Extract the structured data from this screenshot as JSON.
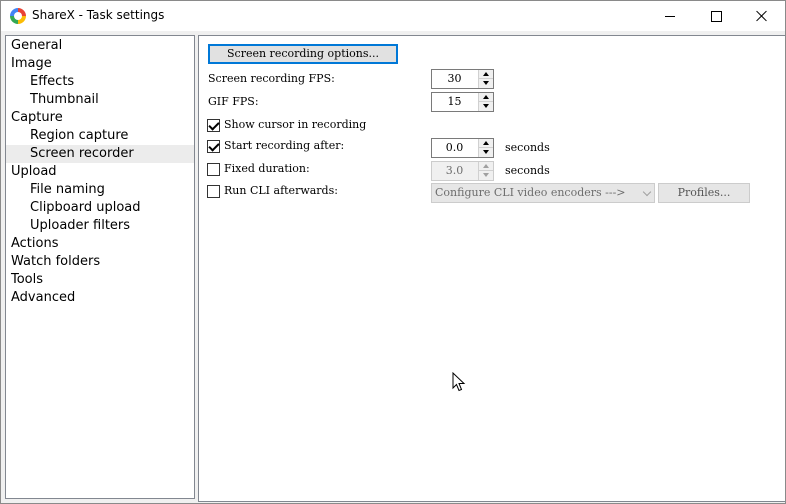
{
  "window": {
    "title": "ShareX - Task settings"
  },
  "nav": {
    "items": [
      {
        "label": "General",
        "level": 0
      },
      {
        "label": "Image",
        "level": 0
      },
      {
        "label": "Effects",
        "level": 1
      },
      {
        "label": "Thumbnail",
        "level": 1
      },
      {
        "label": "Capture",
        "level": 0
      },
      {
        "label": "Region capture",
        "level": 1
      },
      {
        "label": "Screen recorder",
        "level": 1,
        "selected": true
      },
      {
        "label": "Upload",
        "level": 0
      },
      {
        "label": "File naming",
        "level": 1
      },
      {
        "label": "Clipboard upload",
        "level": 1
      },
      {
        "label": "Uploader filters",
        "level": 1
      },
      {
        "label": "Actions",
        "level": 0
      },
      {
        "label": "Watch folders",
        "level": 0
      },
      {
        "label": "Tools",
        "level": 0
      },
      {
        "label": "Advanced",
        "level": 0
      }
    ]
  },
  "screen_recorder": {
    "options_button": "Screen recording options...",
    "fps_label": "Screen recording FPS:",
    "fps_value": "30",
    "gif_fps_label": "GIF FPS:",
    "gif_fps_value": "15",
    "show_cursor_label": "Show cursor in recording",
    "show_cursor_checked": true,
    "start_after_label": "Start recording after:",
    "start_after_checked": true,
    "start_after_value": "0.0",
    "start_after_unit": "seconds",
    "fixed_duration_label": "Fixed duration:",
    "fixed_duration_checked": false,
    "fixed_duration_value": "3.0",
    "fixed_duration_unit": "seconds",
    "run_cli_label": "Run CLI afterwards:",
    "run_cli_checked": false,
    "cli_encoder_select": "Configure CLI video encoders --->",
    "profiles_button": "Profiles..."
  }
}
